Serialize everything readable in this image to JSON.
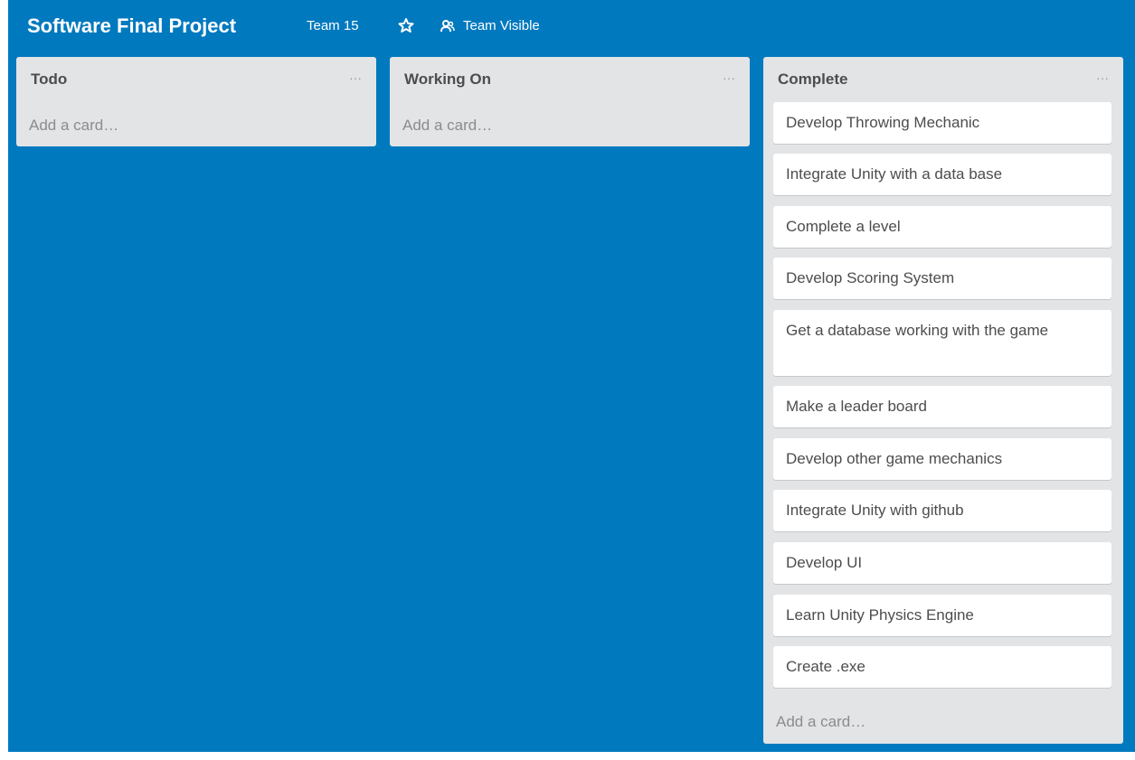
{
  "board": {
    "title": "Software Final Project",
    "team": "Team 15",
    "star_icon": "star-icon",
    "visibility_icon": "team-icon",
    "visibility": "Team Visible",
    "background_color": "#0079bf"
  },
  "lists": [
    {
      "title": "Todo",
      "menu_label": "···",
      "add_card": "Add a card…",
      "cards": []
    },
    {
      "title": "Working On",
      "menu_label": "···",
      "add_card": "Add a card…",
      "cards": []
    },
    {
      "title": "Complete",
      "menu_label": "···",
      "add_card": "Add a card…",
      "cards": [
        "Develop Throwing Mechanic",
        "Integrate Unity with a data base",
        "Complete a level",
        "Develop Scoring System",
        "Get a database working with the game",
        "Make a leader board",
        "Develop other game mechanics",
        "Integrate Unity with github",
        "Develop UI",
        "Learn Unity Physics Engine",
        "Create .exe"
      ]
    }
  ]
}
